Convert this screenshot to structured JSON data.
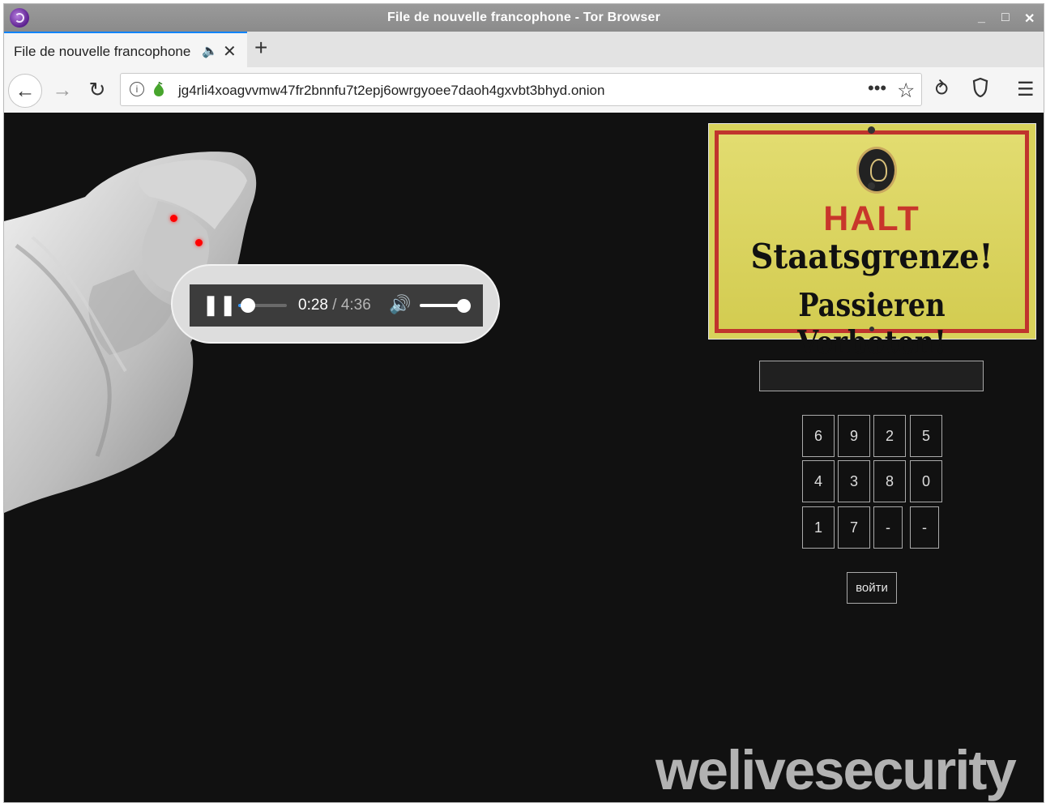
{
  "window": {
    "title": "File de nouvelle francophone - Tor Browser"
  },
  "tabs": [
    {
      "label": "File de nouvelle francophone",
      "audio_icon": "speaker-icon",
      "close_icon": "close-icon"
    }
  ],
  "new_tab_label": "+",
  "address_bar": {
    "url": "jg4rli4xoagvvmw47fr2bnnfu7t2epj6owrgyoee7daoh4gxvbt3bhyd.onion"
  },
  "page": {
    "player": {
      "current_time": "0:28",
      "duration_text": "/ 4:36",
      "playing": true,
      "volume": 1.0,
      "progress": 0.1
    },
    "sign": {
      "line1": "HALT",
      "line2": "Staatsgrenze!",
      "line3": "Passieren Verboten!"
    },
    "code_input_value": "",
    "keypad": [
      [
        "6",
        "9",
        "2",
        "5"
      ],
      [
        "4",
        "3",
        "8",
        "0"
      ],
      [
        "1",
        "7",
        "-",
        "-"
      ]
    ],
    "login_button": "войти",
    "watermark": "welivesecurity"
  },
  "colors": {
    "page_bg": "#111111",
    "accent": "#0a84ff",
    "sign_border": "#c0342d",
    "sign_bg": "#d8d25b"
  }
}
